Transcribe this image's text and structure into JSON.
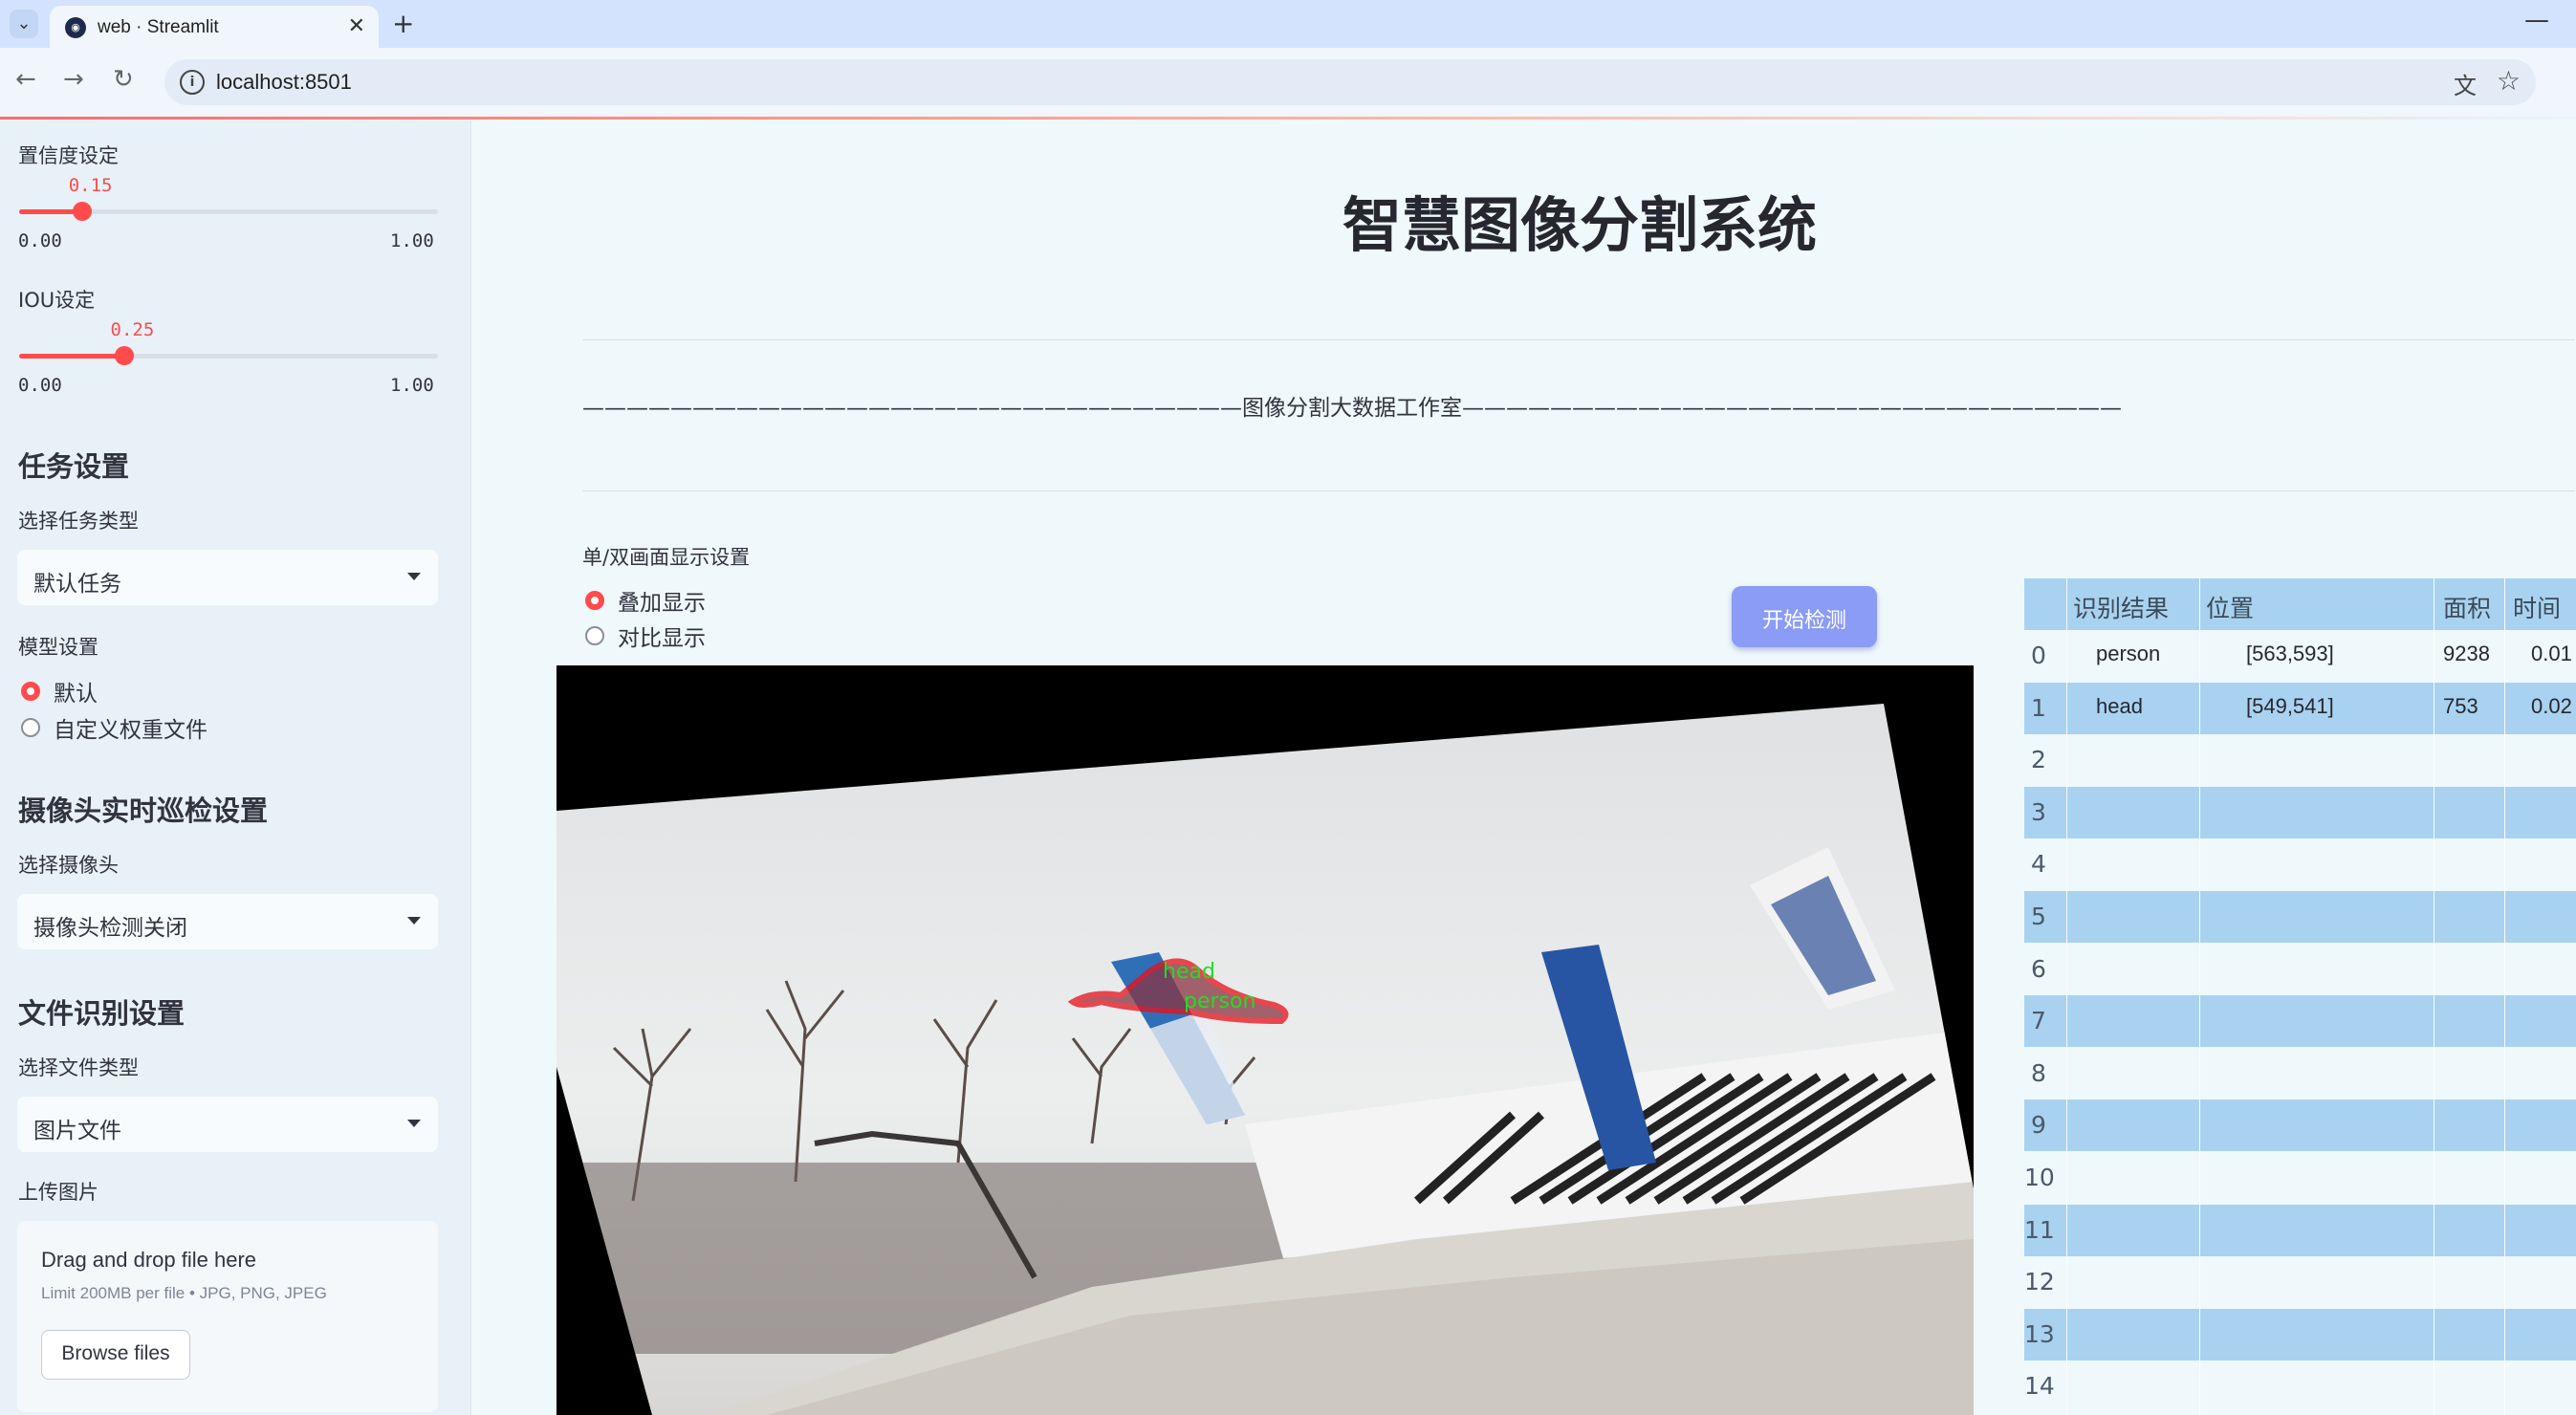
{
  "browser": {
    "tab_title": "web · Streamlit",
    "url": "localhost:8501"
  },
  "sidebar": {
    "confidence": {
      "label": "置信度设定",
      "value": "0.15",
      "value_fraction": 0.15,
      "min": "0.00",
      "max": "1.00"
    },
    "iou": {
      "label": "IOU设定",
      "value": "0.25",
      "value_fraction": 0.25,
      "min": "0.00",
      "max": "1.00"
    },
    "task_section": {
      "title": "任务设置",
      "select_label": "选择任务类型",
      "select_value": "默认任务"
    },
    "model_section": {
      "label": "模型设置",
      "options": [
        "默认",
        "自定义权重文件"
      ],
      "selected_index": 0
    },
    "camera_section": {
      "title": "摄像头实时巡检设置",
      "select_label": "选择摄像头",
      "select_value": "摄像头检测关闭"
    },
    "file_section": {
      "title": "文件识别设置",
      "select_label": "选择文件类型",
      "select_value": "图片文件"
    },
    "upload": {
      "label": "上传图片",
      "drop_title": "Drag and drop file here",
      "limit_text": "Limit 200MB per file • JPG, PNG, JPEG",
      "browse_label": "Browse files"
    }
  },
  "main": {
    "title": "智慧图像分割系统",
    "banner": "——————————————————————————————图像分割大数据工作室——————————————————————————————",
    "display": {
      "label": "单/双画面显示设置",
      "options": [
        "叠加显示",
        "对比显示"
      ],
      "selected_index": 0
    },
    "start_button": "开始检测",
    "detections": [
      {
        "label": "head",
        "color": "#22dd22"
      },
      {
        "label": "person",
        "color": "#22dd22"
      }
    ],
    "mask_color": "#e8101a"
  },
  "results_table": {
    "columns": [
      "识别结果",
      "位置",
      "面积",
      "时间"
    ],
    "rows": [
      {
        "index": "0",
        "result": "person",
        "position": "[563,593]",
        "area": "9238",
        "time": "0.01"
      },
      {
        "index": "1",
        "result": "head",
        "position": "[549,541]",
        "area": "753",
        "time": "0.02"
      },
      {
        "index": "2"
      },
      {
        "index": "3"
      },
      {
        "index": "4"
      },
      {
        "index": "5"
      },
      {
        "index": "6"
      },
      {
        "index": "7"
      },
      {
        "index": "8"
      },
      {
        "index": "9"
      },
      {
        "index": "10"
      },
      {
        "index": "11"
      },
      {
        "index": "12"
      },
      {
        "index": "13"
      },
      {
        "index": "14"
      }
    ]
  },
  "colors": {
    "accent": "#ff4b4b",
    "button": "#8b9cf6",
    "table_header": "#a9d2f0"
  }
}
